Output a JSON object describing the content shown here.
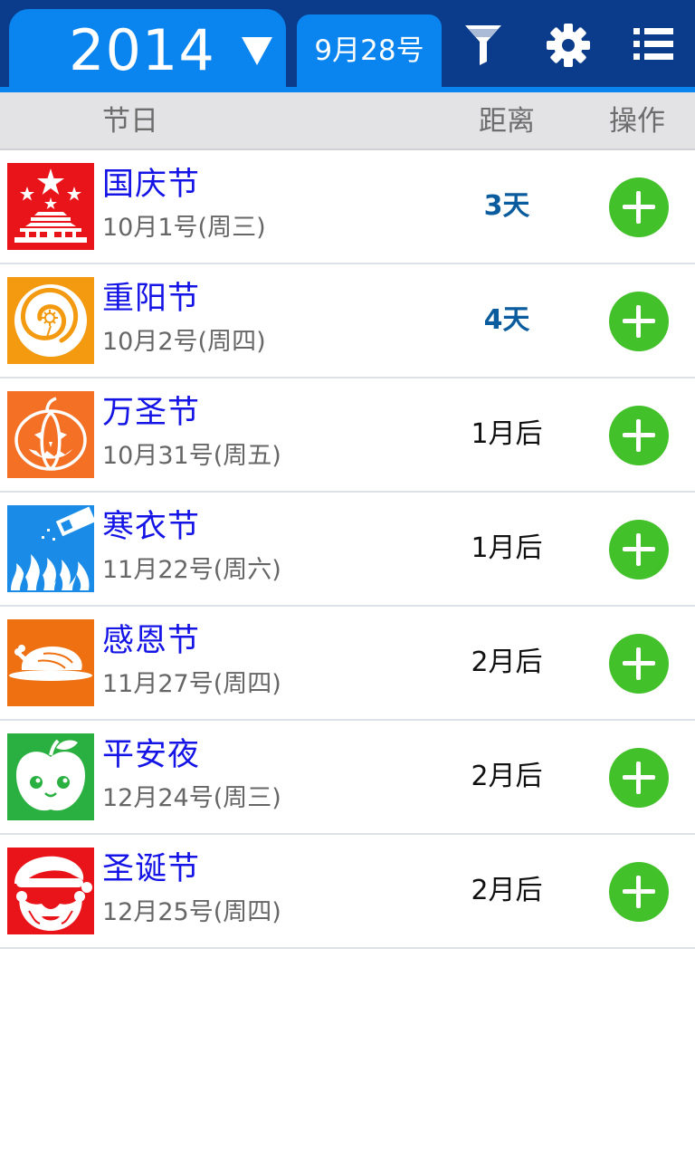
{
  "toolbar": {
    "year": "2014",
    "today": "9月28号",
    "icons": [
      "chevron-down-icon",
      "filter-icon",
      "gear-icon",
      "list-icon"
    ]
  },
  "columns": {
    "holiday": "节日",
    "distance": "距离",
    "action": "操作"
  },
  "colors": {
    "topbar": "#0b3c8c",
    "tab_blue": "#0a84ee",
    "name_blue": "#1414e6",
    "add_green": "#43c12a",
    "soon_blue": "#0b5c9e"
  },
  "holidays": [
    {
      "name": "国庆节",
      "date": "10月1号(周三)",
      "distance": "3天",
      "icon": "national-day-icon",
      "icon_color": "#e8141a"
    },
    {
      "name": "重阳节",
      "date": "10月2号(周四)",
      "distance": "4天",
      "icon": "chongyang-chrysanthemum-icon",
      "icon_color": "#f39a10"
    },
    {
      "name": "万圣节",
      "date": "10月31号(周五)",
      "distance": "1月后",
      "icon": "pumpkin-icon",
      "icon_color": "#f47024"
    },
    {
      "name": "寒衣节",
      "date": "11月22号(周六)",
      "distance": "1月后",
      "icon": "fire-icon",
      "icon_color": "#1a8ce8"
    },
    {
      "name": "感恩节",
      "date": "11月27号(周四)",
      "distance": "2月后",
      "icon": "turkey-icon",
      "icon_color": "#ee7010"
    },
    {
      "name": "平安夜",
      "date": "12月24号(周三)",
      "distance": "2月后",
      "icon": "apple-icon",
      "icon_color": "#2ab040"
    },
    {
      "name": "圣诞节",
      "date": "12月25号(周四)",
      "distance": "2月后",
      "icon": "santa-icon",
      "icon_color": "#e8141a"
    }
  ]
}
